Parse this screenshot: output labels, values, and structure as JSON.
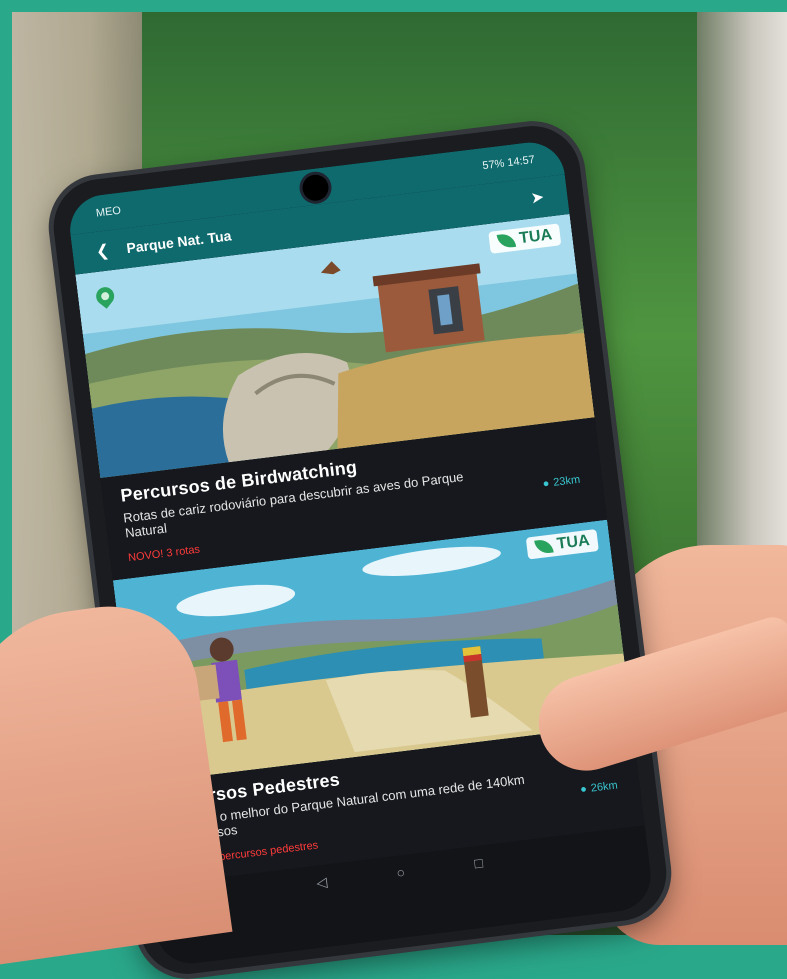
{
  "status_bar": {
    "left": "MEO",
    "right": "57% 14:57"
  },
  "app_bar": {
    "title": "Parque Nat. Tua"
  },
  "cards": [
    {
      "logo": "TUA",
      "title": "Percursos de Birdwatching",
      "description": "Rotas de cariz rodoviário para descubrir as aves do Parque Natural",
      "badge": "NOVO! 3 rotas",
      "distance": "23km"
    },
    {
      "logo": "TUA",
      "title": "Percursos Pedestres",
      "description": "Descubra o melhor do Parque Natural com uma rede de 140km de percursos",
      "badge": "NOVO! 12 percursos pedestres",
      "distance": "26km"
    }
  ],
  "icons": {
    "back": "arrow-left",
    "location": "navigation-arrow",
    "pin": "map-pin",
    "logo": "leaf",
    "nav": [
      "triangle-back",
      "circle-home",
      "square-recents"
    ]
  }
}
